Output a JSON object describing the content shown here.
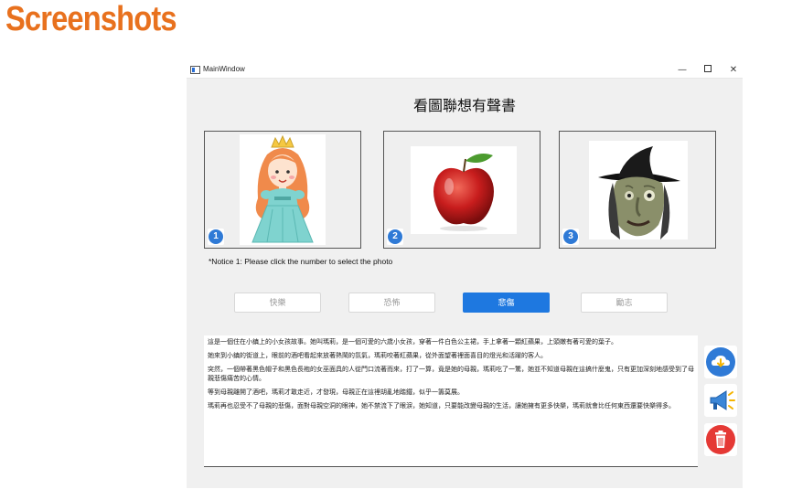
{
  "page": {
    "heading": "Screenshots"
  },
  "window": {
    "title": "MainWindow",
    "controls": {
      "minimize": "—",
      "close": "✕"
    }
  },
  "app": {
    "title": "看圖聯想有聲書",
    "photos": [
      {
        "number": "1",
        "subject": "princess"
      },
      {
        "number": "2",
        "subject": "apple"
      },
      {
        "number": "3",
        "subject": "witch"
      }
    ],
    "notice": "*Notice 1: Please click the number to select the photo",
    "categories": [
      {
        "label": "快樂",
        "selected": false
      },
      {
        "label": "恐怖",
        "selected": false
      },
      {
        "label": "悲傷",
        "selected": true
      },
      {
        "label": "勵志",
        "selected": false
      }
    ],
    "story": [
      "這是一個住在小鎮上的小女孩故事。她叫瑪莉，是一個可愛的六歲小女孩，穿著一件白色公主裙，手上拿著一顆紅蘋果，上頭嫩有著可愛的葉子。",
      "她來到小鎮的街道上，眼前的酒吧看起來放著熱鬧的氛氣，瑪莉咬著紅蘋果，從外面望著裡面喜目的燈光和活躍的客人。",
      "突然，一個帶著黑色帽子和黑色長袍的女巫面具的人從門口流著而來，打了一算，竟是她的母親，瑪莉吃了一驚，她並不知道母親在這搞什麼鬼，只有更加深刻地感受到了母親悲傷痛苦的心情。",
      "等到母親離開了酒吧，瑪莉才敢走近，才發現，母親正在這裡胡亂地踏鐵，似乎一籌莫展。",
      "瑪莉再也忍受不了母親的悲傷，面對母親空洞的眼神，她不禁流下了眼淚，她知道，只要能改變母親的生活，讓她擁有更多快樂，瑪莉就會比任何東西還要快樂得多。"
    ],
    "side_buttons": [
      {
        "icon": "cloud-download-icon"
      },
      {
        "icon": "megaphone-icon"
      },
      {
        "icon": "trash-icon"
      }
    ]
  },
  "colors": {
    "heading": "#e8711e",
    "accent": "#1e78e0",
    "badge": "#2f7ad6",
    "delete": "#e53935"
  }
}
